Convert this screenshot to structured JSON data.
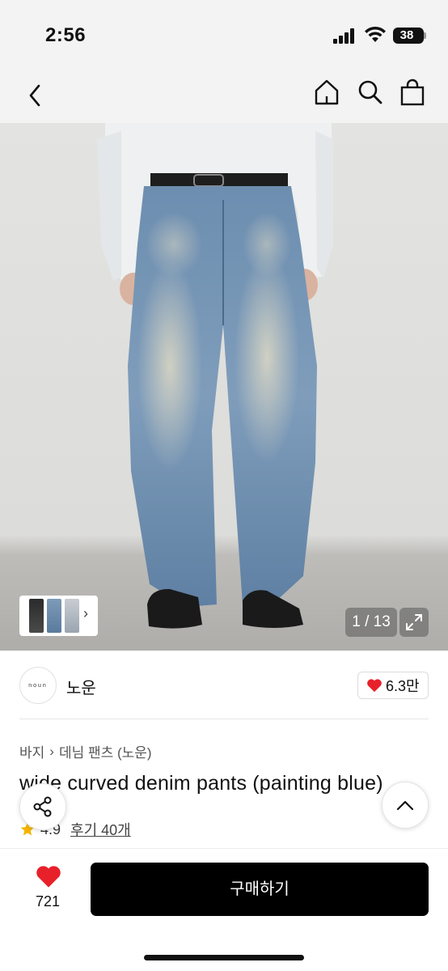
{
  "status_bar": {
    "time": "2:56",
    "battery": "38"
  },
  "nav": {
    "back_icon": "chevron-left-icon",
    "home_icon": "home-icon",
    "search_icon": "search-icon",
    "bag_icon": "shopping-bag-icon"
  },
  "gallery": {
    "counter": "1 / 13",
    "current": 1,
    "total": 13,
    "expand_icon": "expand-icon"
  },
  "shop": {
    "logo_text": "noun",
    "name": "노운",
    "likes": "6.3만"
  },
  "breadcrumb": {
    "items": [
      "바지",
      "데님 팬츠 (노운)"
    ]
  },
  "product": {
    "title": "wide curved denim pants (painting blue)",
    "rating": "4.9",
    "reviews": "후기 40개"
  },
  "bottom_bar": {
    "like_count": "721",
    "buy_label": "구매하기"
  },
  "colors": {
    "like_red": "#e8202a",
    "buy_black": "#000000",
    "star_yellow": "#f4b400"
  }
}
